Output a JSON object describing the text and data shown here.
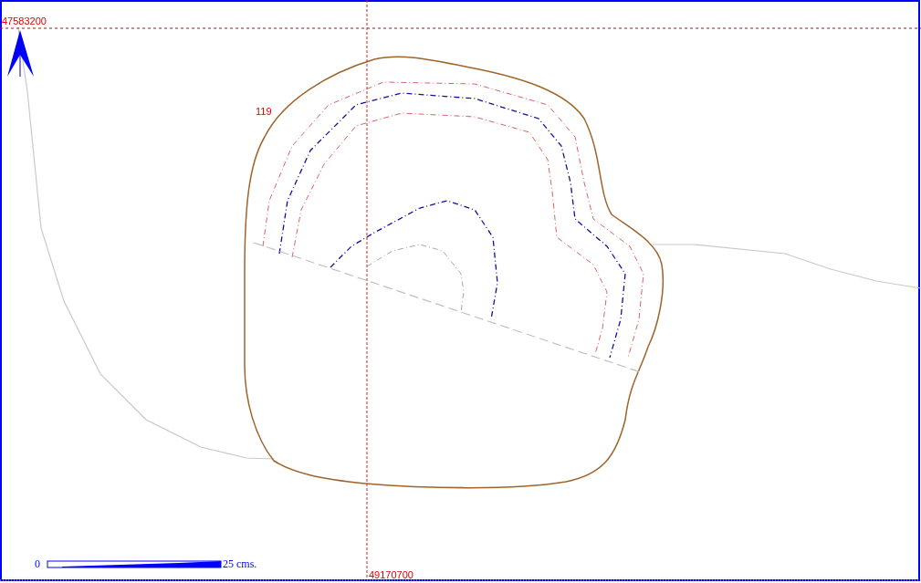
{
  "horizontal_grid_label": "47583200",
  "vertical_grid_label": "49170700",
  "contour_label": "119",
  "scale_bar": {
    "start": "0",
    "end": "25 cms."
  }
}
